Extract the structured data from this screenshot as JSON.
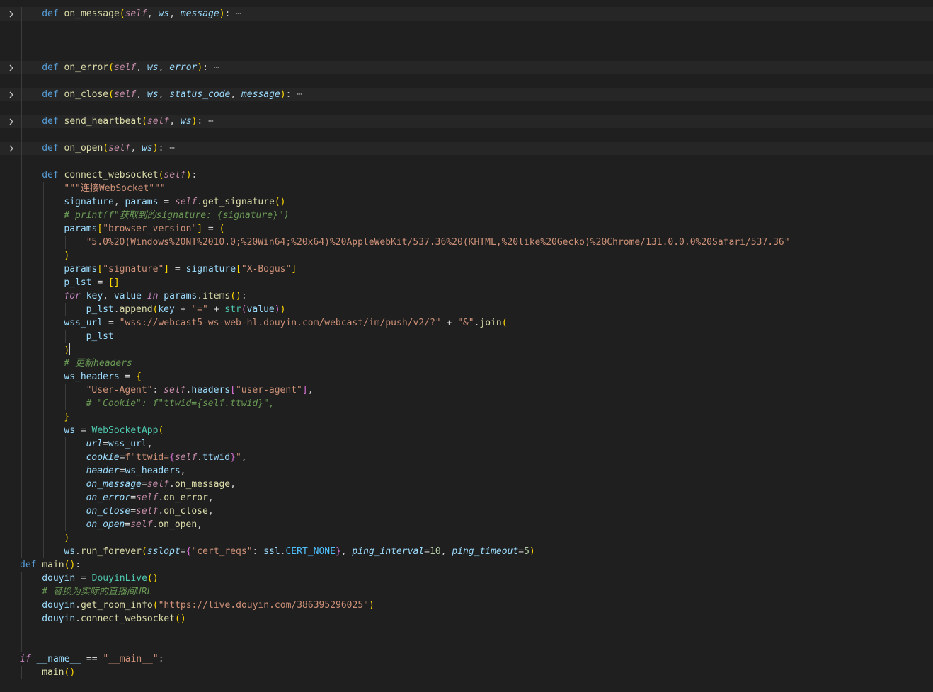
{
  "editor": {
    "language": "python",
    "theme_colors": {
      "background": "#1f1f1f",
      "folded_line": "#262626",
      "keyword": "#569cd6",
      "function": "#dcdcaa",
      "string": "#ce9178",
      "comment": "#6a9955",
      "variable": "#9cdcfe",
      "class": "#4ec9b0"
    },
    "cursor": {
      "line": 26,
      "after_char": ")"
    },
    "lines": [
      {
        "indent": 1,
        "folded": true,
        "tokens": [
          [
            "kw",
            "def "
          ],
          [
            "fn",
            "on_message"
          ],
          [
            "b1",
            "("
          ],
          [
            "self",
            "self"
          ],
          [
            "punc",
            ", "
          ],
          [
            "param",
            "ws"
          ],
          [
            "punc",
            ", "
          ],
          [
            "param",
            "message"
          ],
          [
            "b1",
            ")"
          ],
          [
            "punc",
            ":"
          ],
          [
            "ell",
            " ⋯"
          ]
        ]
      },
      {
        "indent": 0,
        "tokens": []
      },
      {
        "indent": 0,
        "tokens": []
      },
      {
        "indent": 0,
        "tokens": []
      },
      {
        "indent": 1,
        "folded": true,
        "tokens": [
          [
            "kw",
            "def "
          ],
          [
            "fn",
            "on_error"
          ],
          [
            "b1",
            "("
          ],
          [
            "self",
            "self"
          ],
          [
            "punc",
            ", "
          ],
          [
            "param",
            "ws"
          ],
          [
            "punc",
            ", "
          ],
          [
            "param",
            "error"
          ],
          [
            "b1",
            ")"
          ],
          [
            "punc",
            ":"
          ],
          [
            "ell",
            " ⋯"
          ]
        ]
      },
      {
        "indent": 0,
        "tokens": []
      },
      {
        "indent": 1,
        "folded": true,
        "tokens": [
          [
            "kw",
            "def "
          ],
          [
            "fn",
            "on_close"
          ],
          [
            "b1",
            "("
          ],
          [
            "self",
            "self"
          ],
          [
            "punc",
            ", "
          ],
          [
            "param",
            "ws"
          ],
          [
            "punc",
            ", "
          ],
          [
            "param",
            "status_code"
          ],
          [
            "punc",
            ", "
          ],
          [
            "param",
            "message"
          ],
          [
            "b1",
            ")"
          ],
          [
            "punc",
            ":"
          ],
          [
            "ell",
            " ⋯"
          ]
        ]
      },
      {
        "indent": 0,
        "tokens": []
      },
      {
        "indent": 1,
        "folded": true,
        "tokens": [
          [
            "kw",
            "def "
          ],
          [
            "fn",
            "send_heartbeat"
          ],
          [
            "b1",
            "("
          ],
          [
            "self",
            "self"
          ],
          [
            "punc",
            ", "
          ],
          [
            "param",
            "ws"
          ],
          [
            "b1",
            ")"
          ],
          [
            "punc",
            ":"
          ],
          [
            "ell",
            " ⋯"
          ]
        ]
      },
      {
        "indent": 0,
        "tokens": []
      },
      {
        "indent": 1,
        "folded": true,
        "tokens": [
          [
            "kw",
            "def "
          ],
          [
            "fn",
            "on_open"
          ],
          [
            "b1",
            "("
          ],
          [
            "self",
            "self"
          ],
          [
            "punc",
            ", "
          ],
          [
            "param",
            "ws"
          ],
          [
            "b1",
            ")"
          ],
          [
            "punc",
            ":"
          ],
          [
            "ell",
            " ⋯"
          ]
        ]
      },
      {
        "indent": 0,
        "tokens": []
      },
      {
        "indent": 1,
        "tokens": [
          [
            "kw",
            "def "
          ],
          [
            "fn",
            "connect_websocket"
          ],
          [
            "b1",
            "("
          ],
          [
            "self",
            "self"
          ],
          [
            "b1",
            ")"
          ],
          [
            "punc",
            ":"
          ]
        ]
      },
      {
        "indent": 2,
        "tokens": [
          [
            "str",
            "\"\"\"连接WebSocket\"\"\""
          ]
        ]
      },
      {
        "indent": 2,
        "tokens": [
          [
            "var",
            "signature"
          ],
          [
            "punc",
            ", "
          ],
          [
            "var",
            "params"
          ],
          [
            "op",
            " = "
          ],
          [
            "self",
            "self"
          ],
          [
            "punc",
            "."
          ],
          [
            "fn",
            "get_signature"
          ],
          [
            "b1",
            "()"
          ]
        ]
      },
      {
        "indent": 2,
        "tokens": [
          [
            "cm",
            "# print(f\"获取到的signature: {signature}\")"
          ]
        ]
      },
      {
        "indent": 2,
        "tokens": [
          [
            "var",
            "params"
          ],
          [
            "b1",
            "["
          ],
          [
            "str",
            "\"browser_version\""
          ],
          [
            "b1",
            "]"
          ],
          [
            "op",
            " = "
          ],
          [
            "b1",
            "("
          ]
        ]
      },
      {
        "indent": 3,
        "tokens": [
          [
            "str",
            "\"5.0%20(Windows%20NT%2010.0;%20Win64;%20x64)%20AppleWebKit/537.36%20(KHTML,%20like%20Gecko)%20Chrome/131.0.0.0%20Safari/537.36\""
          ]
        ]
      },
      {
        "indent": 2,
        "tokens": [
          [
            "b1",
            ")"
          ]
        ]
      },
      {
        "indent": 2,
        "tokens": [
          [
            "var",
            "params"
          ],
          [
            "b1",
            "["
          ],
          [
            "str",
            "\"signature\""
          ],
          [
            "b1",
            "]"
          ],
          [
            "op",
            " = "
          ],
          [
            "var",
            "signature"
          ],
          [
            "b1",
            "["
          ],
          [
            "str",
            "\"X-Bogus\""
          ],
          [
            "b1",
            "]"
          ]
        ]
      },
      {
        "indent": 2,
        "tokens": [
          [
            "var",
            "p_lst"
          ],
          [
            "op",
            " = "
          ],
          [
            "b1",
            "[]"
          ]
        ]
      },
      {
        "indent": 2,
        "tokens": [
          [
            "ctl",
            "for"
          ],
          [
            "punc",
            " "
          ],
          [
            "var",
            "key"
          ],
          [
            "punc",
            ", "
          ],
          [
            "var",
            "value"
          ],
          [
            "punc",
            " "
          ],
          [
            "ctl",
            "in"
          ],
          [
            "punc",
            " "
          ],
          [
            "var",
            "params"
          ],
          [
            "punc",
            "."
          ],
          [
            "fn",
            "items"
          ],
          [
            "b1",
            "()"
          ],
          [
            "punc",
            ":"
          ]
        ]
      },
      {
        "indent": 3,
        "tokens": [
          [
            "var",
            "p_lst"
          ],
          [
            "punc",
            "."
          ],
          [
            "fn",
            "append"
          ],
          [
            "b1",
            "("
          ],
          [
            "var",
            "key"
          ],
          [
            "op",
            " + "
          ],
          [
            "str",
            "\"=\""
          ],
          [
            "op",
            " + "
          ],
          [
            "cls",
            "str"
          ],
          [
            "b2",
            "("
          ],
          [
            "var",
            "value"
          ],
          [
            "b2",
            ")"
          ],
          [
            "b1",
            ")"
          ]
        ]
      },
      {
        "indent": 2,
        "tokens": [
          [
            "var",
            "wss_url"
          ],
          [
            "op",
            " = "
          ],
          [
            "str",
            "\"wss://webcast5-ws-web-hl.douyin.com/webcast/im/push/v2/?\""
          ],
          [
            "op",
            " + "
          ],
          [
            "str",
            "\"&\""
          ],
          [
            "punc",
            "."
          ],
          [
            "fn",
            "join"
          ],
          [
            "b1",
            "("
          ]
        ]
      },
      {
        "indent": 3,
        "tokens": [
          [
            "var",
            "p_lst"
          ]
        ]
      },
      {
        "indent": 2,
        "tokens": [
          [
            "b1",
            ")"
          ],
          [
            "cursor",
            ""
          ]
        ]
      },
      {
        "indent": 2,
        "tokens": [
          [
            "cm",
            "# 更新headers"
          ]
        ]
      },
      {
        "indent": 2,
        "tokens": [
          [
            "var",
            "ws_headers"
          ],
          [
            "op",
            " = "
          ],
          [
            "b1",
            "{"
          ]
        ]
      },
      {
        "indent": 3,
        "tokens": [
          [
            "str",
            "\"User-Agent\""
          ],
          [
            "punc",
            ": "
          ],
          [
            "self",
            "self"
          ],
          [
            "punc",
            "."
          ],
          [
            "var",
            "headers"
          ],
          [
            "b2",
            "["
          ],
          [
            "str",
            "\"user-agent\""
          ],
          [
            "b2",
            "]"
          ],
          [
            "punc",
            ","
          ]
        ]
      },
      {
        "indent": 3,
        "tokens": [
          [
            "cm",
            "# \"Cookie\": f\"ttwid={self.ttwid}\","
          ]
        ]
      },
      {
        "indent": 2,
        "tokens": [
          [
            "b1",
            "}"
          ]
        ]
      },
      {
        "indent": 2,
        "tokens": [
          [
            "var",
            "ws"
          ],
          [
            "op",
            " = "
          ],
          [
            "cls",
            "WebSocketApp"
          ],
          [
            "b1",
            "("
          ]
        ]
      },
      {
        "indent": 3,
        "tokens": [
          [
            "param",
            "url"
          ],
          [
            "op",
            "="
          ],
          [
            "var",
            "wss_url"
          ],
          [
            "punc",
            ","
          ]
        ]
      },
      {
        "indent": 3,
        "tokens": [
          [
            "param",
            "cookie"
          ],
          [
            "op",
            "="
          ],
          [
            "str",
            "f\"ttwid="
          ],
          [
            "b2",
            "{"
          ],
          [
            "self",
            "self"
          ],
          [
            "punc",
            "."
          ],
          [
            "var",
            "ttwid"
          ],
          [
            "b2",
            "}"
          ],
          [
            "str",
            "\""
          ],
          [
            "punc",
            ","
          ]
        ]
      },
      {
        "indent": 3,
        "tokens": [
          [
            "param",
            "header"
          ],
          [
            "op",
            "="
          ],
          [
            "var",
            "ws_headers"
          ],
          [
            "punc",
            ","
          ]
        ]
      },
      {
        "indent": 3,
        "tokens": [
          [
            "param",
            "on_message"
          ],
          [
            "op",
            "="
          ],
          [
            "self",
            "self"
          ],
          [
            "punc",
            "."
          ],
          [
            "fn",
            "on_message"
          ],
          [
            "punc",
            ","
          ]
        ]
      },
      {
        "indent": 3,
        "tokens": [
          [
            "param",
            "on_error"
          ],
          [
            "op",
            "="
          ],
          [
            "self",
            "self"
          ],
          [
            "punc",
            "."
          ],
          [
            "fn",
            "on_error"
          ],
          [
            "punc",
            ","
          ]
        ]
      },
      {
        "indent": 3,
        "tokens": [
          [
            "param",
            "on_close"
          ],
          [
            "op",
            "="
          ],
          [
            "self",
            "self"
          ],
          [
            "punc",
            "."
          ],
          [
            "fn",
            "on_close"
          ],
          [
            "punc",
            ","
          ]
        ]
      },
      {
        "indent": 3,
        "tokens": [
          [
            "param",
            "on_open"
          ],
          [
            "op",
            "="
          ],
          [
            "self",
            "self"
          ],
          [
            "punc",
            "."
          ],
          [
            "fn",
            "on_open"
          ],
          [
            "punc",
            ","
          ]
        ]
      },
      {
        "indent": 2,
        "tokens": [
          [
            "b1",
            ")"
          ]
        ]
      },
      {
        "indent": 2,
        "tokens": [
          [
            "var",
            "ws"
          ],
          [
            "punc",
            "."
          ],
          [
            "fn",
            "run_forever"
          ],
          [
            "b1",
            "("
          ],
          [
            "param",
            "sslopt"
          ],
          [
            "op",
            "="
          ],
          [
            "b2",
            "{"
          ],
          [
            "str",
            "\"cert_reqs\""
          ],
          [
            "punc",
            ": "
          ],
          [
            "var",
            "ssl"
          ],
          [
            "punc",
            "."
          ],
          [
            "const",
            "CERT_NONE"
          ],
          [
            "b2",
            "}"
          ],
          [
            "punc",
            ", "
          ],
          [
            "param",
            "ping_interval"
          ],
          [
            "op",
            "="
          ],
          [
            "num",
            "10"
          ],
          [
            "punc",
            ", "
          ],
          [
            "param",
            "ping_timeout"
          ],
          [
            "op",
            "="
          ],
          [
            "num",
            "5"
          ],
          [
            "b1",
            ")"
          ]
        ]
      },
      {
        "indent": 0,
        "tokens": [
          [
            "kw",
            "def "
          ],
          [
            "fn",
            "main"
          ],
          [
            "b1",
            "()"
          ],
          [
            "punc",
            ":"
          ]
        ]
      },
      {
        "indent": 1,
        "tokens": [
          [
            "var",
            "douyin"
          ],
          [
            "op",
            " = "
          ],
          [
            "cls",
            "DouyinLive"
          ],
          [
            "b1",
            "()"
          ]
        ]
      },
      {
        "indent": 1,
        "tokens": [
          [
            "cm",
            "# 替换为实际的直播间URL"
          ]
        ]
      },
      {
        "indent": 1,
        "tokens": [
          [
            "var",
            "douyin"
          ],
          [
            "punc",
            "."
          ],
          [
            "fn",
            "get_room_info"
          ],
          [
            "b1",
            "("
          ],
          [
            "str",
            "\""
          ],
          [
            "link",
            "https://live.douyin.com/386395296025"
          ],
          [
            "str",
            "\""
          ],
          [
            "b1",
            ")"
          ]
        ]
      },
      {
        "indent": 1,
        "tokens": [
          [
            "var",
            "douyin"
          ],
          [
            "punc",
            "."
          ],
          [
            "fn",
            "connect_websocket"
          ],
          [
            "b1",
            "()"
          ]
        ]
      },
      {
        "indent": 0,
        "tokens": []
      },
      {
        "indent": 0,
        "tokens": []
      },
      {
        "indent": 0,
        "tokens": [
          [
            "ctl",
            "if"
          ],
          [
            "punc",
            " "
          ],
          [
            "var",
            "__name__"
          ],
          [
            "op",
            " == "
          ],
          [
            "str",
            "\"__main__\""
          ],
          [
            "punc",
            ":"
          ]
        ]
      },
      {
        "indent": 1,
        "tokens": [
          [
            "fn",
            "main"
          ],
          [
            "b1",
            "()"
          ]
        ]
      }
    ]
  }
}
